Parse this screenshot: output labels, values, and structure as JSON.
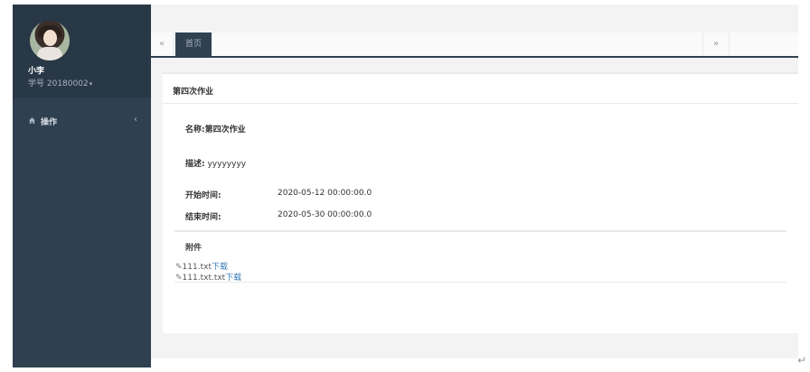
{
  "user": {
    "name": "小李",
    "id": "学号 20180002"
  },
  "sidebar": {
    "items": [
      {
        "label": "操作",
        "icon": "home-icon"
      }
    ]
  },
  "tabs": {
    "left_arrow": "«",
    "home_label": "首页",
    "right_arrow": "»"
  },
  "panel": {
    "title": "第四次作业",
    "name_label": "名称:",
    "name_value": "第四次作业",
    "desc_label": "描述:",
    "desc_value": "yyyyyyyy",
    "start_label": "开始时间:",
    "start_value": "2020-05-12 00:00:00.0",
    "end_label": "结束时间:",
    "end_value": "2020-05-30 00:00:00.0",
    "attachments_title": "附件",
    "attachments": [
      {
        "file": "111.txt",
        "link": "下载"
      },
      {
        "file": "111.txt.txt",
        "link": "下载"
      }
    ]
  },
  "colors": {
    "sidebar": "#2f4050",
    "profile": "#293846",
    "link": "#337ab7"
  }
}
